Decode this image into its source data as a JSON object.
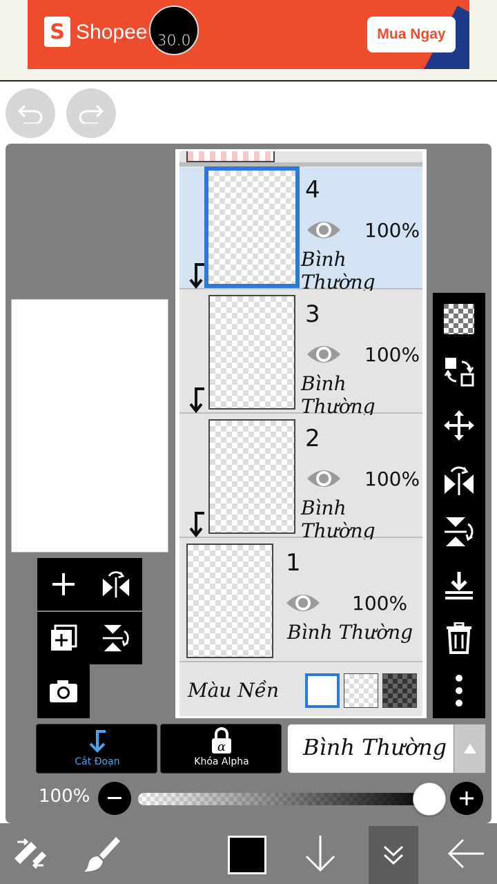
{
  "ad": {
    "brand": "Shopee",
    "cta": "Mua Ngay"
  },
  "layers": [
    {
      "name": "4",
      "opacity": "100%",
      "blend": "Bình Thường",
      "selected": true,
      "clipped": true
    },
    {
      "name": "3",
      "opacity": "100%",
      "blend": "Bình Thường",
      "selected": false,
      "clipped": true
    },
    {
      "name": "2",
      "opacity": "100%",
      "blend": "Bình Thường",
      "selected": false,
      "clipped": true
    },
    {
      "name": "1",
      "opacity": "100%",
      "blend": "Bình Thường",
      "selected": false,
      "clipped": false
    }
  ],
  "background": {
    "label": "Màu Nền",
    "selected_option": "white"
  },
  "controls": {
    "clip_label": "Cắt Đoạn",
    "alpha_lock_label": "Khóa Alpha",
    "blend_mode": "Bình Thường",
    "opacity_label": "100%",
    "opacity_value": 1.0
  },
  "toolbar": {
    "brush_size": "30.0",
    "current_color": "#000000"
  },
  "colors": {
    "accent": "#2b7bd6",
    "selected_layer_bg": "#d3e3f4",
    "panel": "#7f7f7f",
    "ad": "#ee4d2d"
  }
}
